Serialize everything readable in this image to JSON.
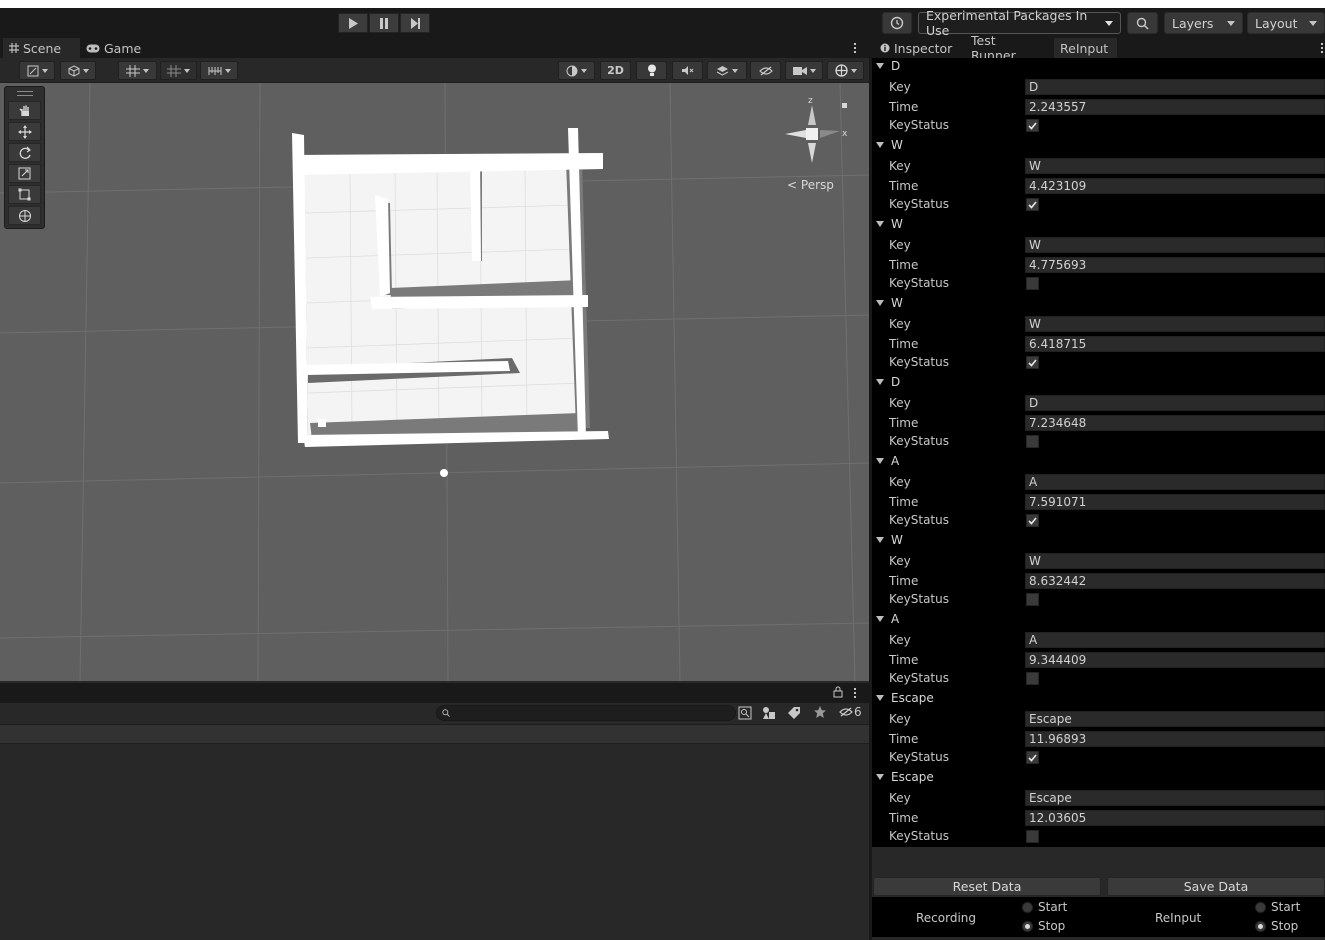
{
  "toolbar": {
    "packages_label": "Experimental Packages In Use",
    "layers_label": "Layers",
    "layout_label": "Layout"
  },
  "scene_view": {
    "tabs": [
      {
        "label": "Scene"
      },
      {
        "label": "Game"
      }
    ],
    "toggle_2d": "2D",
    "projection_label": "Persp",
    "gizmo_axes": {
      "x": "x",
      "z": "z"
    }
  },
  "hierarchy": {
    "hidden_count": "6"
  },
  "inspector": {
    "tabs": [
      {
        "label": "Inspector"
      },
      {
        "label": "Test Runner"
      },
      {
        "label": "ReInput"
      }
    ],
    "field_labels": {
      "key": "Key",
      "time": "Time",
      "status": "KeyStatus"
    },
    "entries": [
      {
        "header": "D",
        "key": "D",
        "time": "2.243557",
        "status": true
      },
      {
        "header": "W",
        "key": "W",
        "time": "4.423109",
        "status": true
      },
      {
        "header": "W",
        "key": "W",
        "time": "4.775693",
        "status": false
      },
      {
        "header": "W",
        "key": "W",
        "time": "6.418715",
        "status": true
      },
      {
        "header": "D",
        "key": "D",
        "time": "7.234648",
        "status": false
      },
      {
        "header": "A",
        "key": "A",
        "time": "7.591071",
        "status": true
      },
      {
        "header": "W",
        "key": "W",
        "time": "8.632442",
        "status": false
      },
      {
        "header": "A",
        "key": "A",
        "time": "9.344409",
        "status": false
      },
      {
        "header": "Escape",
        "key": "Escape",
        "time": "11.96893",
        "status": true
      },
      {
        "header": "Escape",
        "key": "Escape",
        "time": "12.03605",
        "status": false
      }
    ],
    "buttons": {
      "reset": "Reset Data",
      "save": "Save Data"
    },
    "recording": {
      "label": "Recording",
      "start": "Start",
      "stop": "Stop",
      "selected": "Stop"
    },
    "reinput": {
      "label": "ReInput",
      "start": "Start",
      "stop": "Stop",
      "selected": "Stop"
    }
  }
}
